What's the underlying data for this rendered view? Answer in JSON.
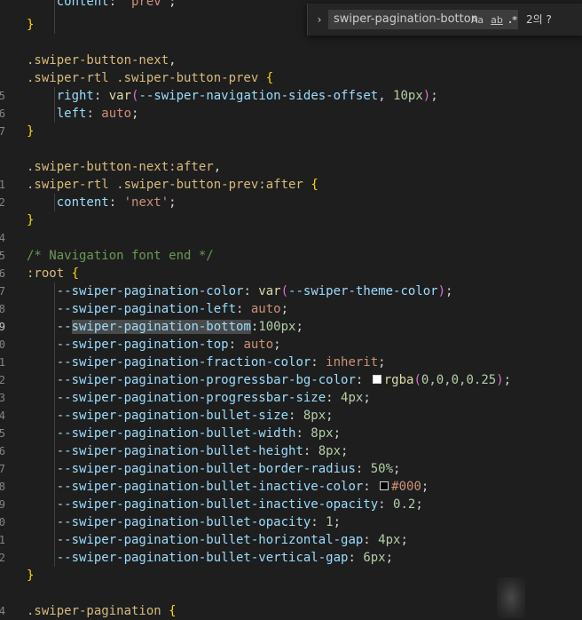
{
  "line_numbers": [
    "",
    "1",
    "",
    "",
    "5",
    "6",
    "7",
    "",
    "",
    "",
    "1",
    "2",
    "",
    "4",
    "5",
    "6",
    "7",
    "8",
    "9",
    "0",
    "1",
    "2",
    "3",
    "4",
    "5",
    "6",
    "7",
    "8",
    "9",
    "0",
    "1",
    "2",
    "",
    "4"
  ],
  "code": {
    "l0": {
      "prop": "content",
      "colon": ": ",
      "str": "'prev'",
      "semi": ";"
    },
    "l2": {
      "sel": ".swiper-button-next",
      "comma": ","
    },
    "l3": {
      "sel": ".swiper-rtl .swiper-button-prev",
      "brace": "{"
    },
    "l4": {
      "prop": "right",
      "colon": ": ",
      "fn": "var",
      "paren_open": "(",
      "var": "--swiper-navigation-sides-offset",
      "comma": ", ",
      "num": "10px",
      "paren_close": ")",
      "semi": ";"
    },
    "l5": {
      "prop": "left",
      "colon": ": ",
      "kw": "auto",
      "semi": ";"
    },
    "l6": {
      "brace": "}"
    },
    "l8": {
      "sel": ".swiper-button-next:after",
      "comma": ","
    },
    "l9": {
      "sel": ".swiper-rtl .swiper-button-prev:after",
      "brace": "{"
    },
    "l10": {
      "prop": "content",
      "colon": ": ",
      "str": "'next'",
      "semi": ";"
    },
    "l11": {
      "brace": "}"
    },
    "l13": {
      "comment": "/* Navigation font end */"
    },
    "l14": {
      "sel": ":root",
      "brace": "{"
    },
    "l15": {
      "prop": "--swiper-pagination-color",
      "colon": ": ",
      "fn": "var",
      "paren_open": "(",
      "var": "--swiper-theme-color",
      "paren_close": ")",
      "semi": ";"
    },
    "l16": {
      "prop": "--swiper-pagination-left",
      "colon": ": ",
      "kw": "auto",
      "semi": ";"
    },
    "l17": {
      "prop_pre": "--",
      "prop_hl": "swiper-pagination-bottom",
      "colon": ":",
      "num": "100px",
      "semi": ";"
    },
    "l18": {
      "prop": "--swiper-pagination-top",
      "colon": ": ",
      "kw": "auto",
      "semi": ";"
    },
    "l19": {
      "prop": "--swiper-pagination-fraction-color",
      "colon": ": ",
      "kw": "inherit",
      "semi": ";"
    },
    "l20": {
      "prop": "--swiper-pagination-progressbar-bg-color",
      "colon": ": ",
      "fn": "rgba",
      "paren_open": "(",
      "args": "0,0,0,0.25",
      "paren_close": ")",
      "semi": ";"
    },
    "l21": {
      "prop": "--swiper-pagination-progressbar-size",
      "colon": ": ",
      "num": "4px",
      "semi": ";"
    },
    "l22": {
      "prop": "--swiper-pagination-bullet-size",
      "colon": ": ",
      "num": "8px",
      "semi": ";"
    },
    "l23": {
      "prop": "--swiper-pagination-bullet-width",
      "colon": ": ",
      "num": "8px",
      "semi": ";"
    },
    "l24": {
      "prop": "--swiper-pagination-bullet-height",
      "colon": ": ",
      "num": "8px",
      "semi": ";"
    },
    "l25": {
      "prop": "--swiper-pagination-bullet-border-radius",
      "colon": ": ",
      "num": "50%",
      "semi": ";"
    },
    "l26": {
      "prop": "--swiper-pagination-bullet-inactive-color",
      "colon": ": ",
      "str": "#000",
      "semi": ";"
    },
    "l27": {
      "prop": "--swiper-pagination-bullet-inactive-opacity",
      "colon": ": ",
      "num": "0.2",
      "semi": ";"
    },
    "l28": {
      "prop": "--swiper-pagination-bullet-opacity",
      "colon": ": ",
      "num": "1",
      "semi": ";"
    },
    "l29": {
      "prop": "--swiper-pagination-bullet-horizontal-gap",
      "colon": ": ",
      "num": "4px",
      "semi": ";"
    },
    "l30": {
      "prop": "--swiper-pagination-bullet-vertical-gap",
      "colon": ": ",
      "num": "6px",
      "semi": ";"
    },
    "l31": {
      "brace": "}"
    },
    "l33": {
      "sel": ".swiper-pagination",
      "brace": "{"
    }
  },
  "find_widget": {
    "toggle_icon": "chevron-right-icon",
    "toggle_glyph": "›",
    "query": "swiper-pagination-botton",
    "match_case": "Aa",
    "whole_word": "ab",
    "regex": ".*",
    "result": "2의 ?"
  }
}
